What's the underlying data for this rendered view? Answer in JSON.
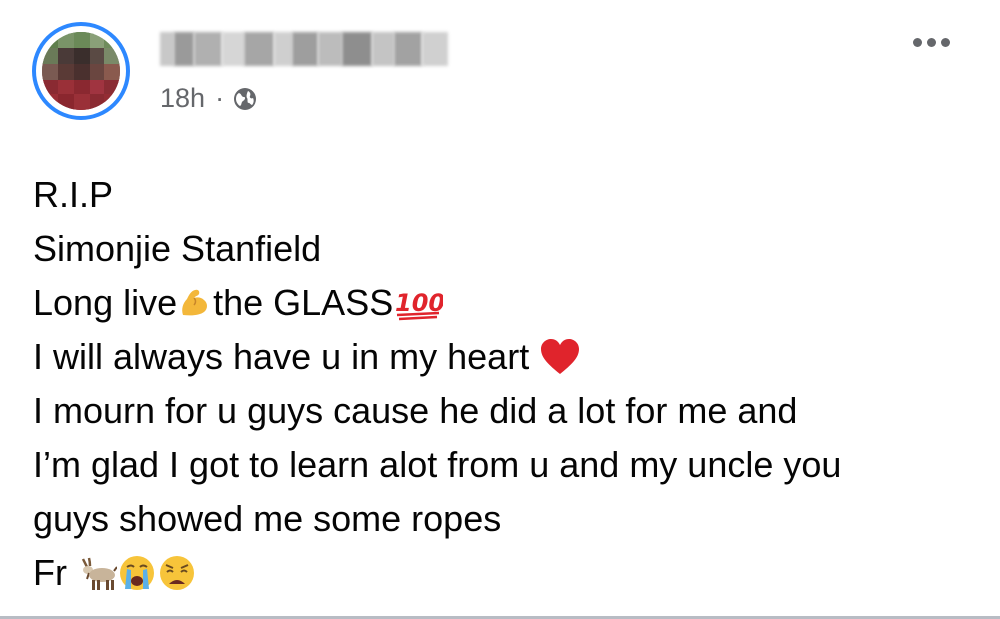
{
  "post": {
    "timestamp": "18h",
    "separator": "·",
    "privacy_icon": "globe-icon",
    "more_icon": "more-options-icon",
    "lines": [
      {
        "text": "R.I.P"
      },
      {
        "text": "Simonjie Stanfield"
      },
      {
        "text_before": "Long live",
        "text_after": " the GLASS"
      },
      {
        "text": "I will always have u in my heart "
      },
      {
        "text": "I mourn for u guys cause he did a lot for me and"
      },
      {
        "text": "I’m glad I got to learn alot from u and my uncle you"
      },
      {
        "text": "guys showed me some ropes"
      },
      {
        "text": "Fr "
      }
    ],
    "emojis": {
      "line3_a": "flexed-biceps-icon",
      "line3_b": "hundred-points-icon",
      "line4": "red-heart-icon",
      "line8": [
        "goat-icon",
        "loudly-crying-face-icon",
        "weary-face-icon"
      ]
    },
    "hundred_label": "100"
  },
  "colors": {
    "avatar_ring": "#2d88ff",
    "meta_text": "#65676b",
    "body_text": "#050505",
    "heart": "#e0242c",
    "hundred": "#e0242c"
  }
}
